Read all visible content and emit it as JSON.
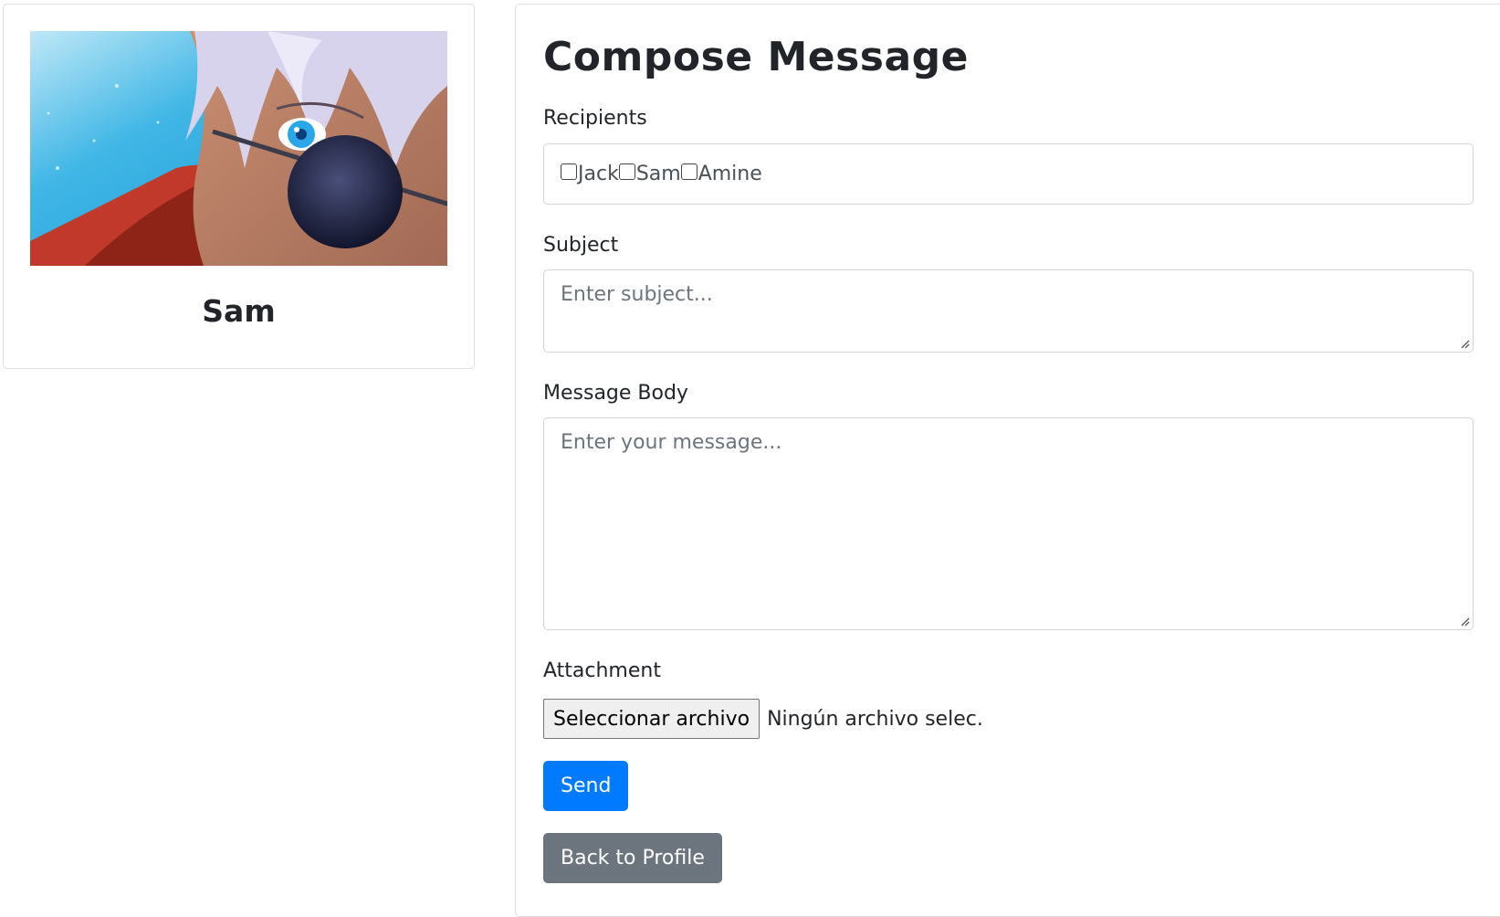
{
  "profile": {
    "name": "Sam",
    "avatar_alt": "anime-character-avatar"
  },
  "compose": {
    "title": "Compose Message",
    "recipients_label": "Recipients",
    "recipients": [
      {
        "name": "Jack",
        "checked": false
      },
      {
        "name": "Sam",
        "checked": false
      },
      {
        "name": "Amine",
        "checked": false
      }
    ],
    "subject_label": "Subject",
    "subject_placeholder": "Enter subject...",
    "body_label": "Message Body",
    "body_placeholder": "Enter your message...",
    "attachment_label": "Attachment",
    "file_button_label": "Seleccionar archivo",
    "file_status": "Ningún archivo selec.",
    "send_label": "Send",
    "back_label": "Back to Profile"
  },
  "colors": {
    "primary": "#007bff",
    "secondary": "#6c757d",
    "border": "#dfdfdf",
    "input_border": "#ced4da"
  }
}
